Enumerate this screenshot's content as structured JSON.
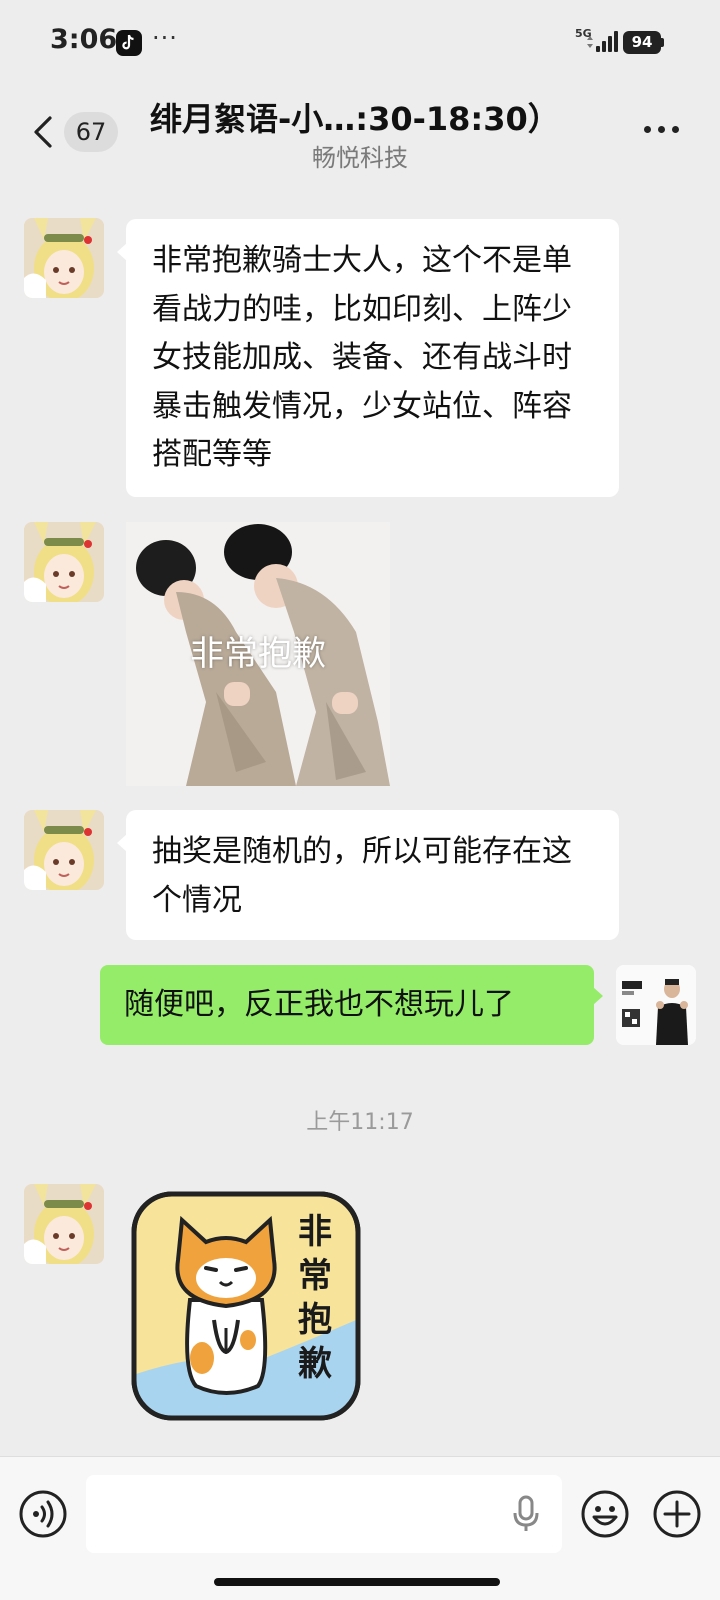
{
  "status_bar": {
    "time": "3:06",
    "app_icon": "tiktok-icon",
    "more_indicator": "···",
    "network": "5G",
    "battery": "94"
  },
  "header": {
    "unread_count": "67",
    "title": "绯月絮语-小…:30-18:30）",
    "subtitle": "畅悦科技",
    "icons": [
      "back-icon",
      "more-icon"
    ]
  },
  "messages": [
    {
      "direction": "in",
      "type": "text",
      "text": "非常抱歉骑士大人，这个不是单看战力的哇，比如印刻、上阵少女技能加成、装备、还有战斗时暴击触发情况，少女站位、阵容搭配等等"
    },
    {
      "direction": "in",
      "type": "image",
      "caption": "非常抱歉"
    },
    {
      "direction": "in",
      "type": "text",
      "text": "抽奖是随机的，所以可能存在这个情况"
    },
    {
      "direction": "out",
      "type": "text",
      "text": "随便吧，反正我也不想玩儿了"
    },
    {
      "type": "timestamp",
      "text": "上午11:17"
    },
    {
      "direction": "in",
      "type": "sticker",
      "text": "非常抱歉"
    }
  ],
  "input_bar": {
    "placeholder": "",
    "icons": [
      "voice-icon",
      "mic-icon",
      "emoji-icon",
      "plus-icon"
    ]
  },
  "colors": {
    "background": "#ededed",
    "outgoing_bubble": "#95ec69",
    "incoming_bubble": "#ffffff",
    "sticker_yellow": "#f7e39a",
    "sticker_blue": "#a9d4ef",
    "cat_orange": "#f0a33c"
  }
}
